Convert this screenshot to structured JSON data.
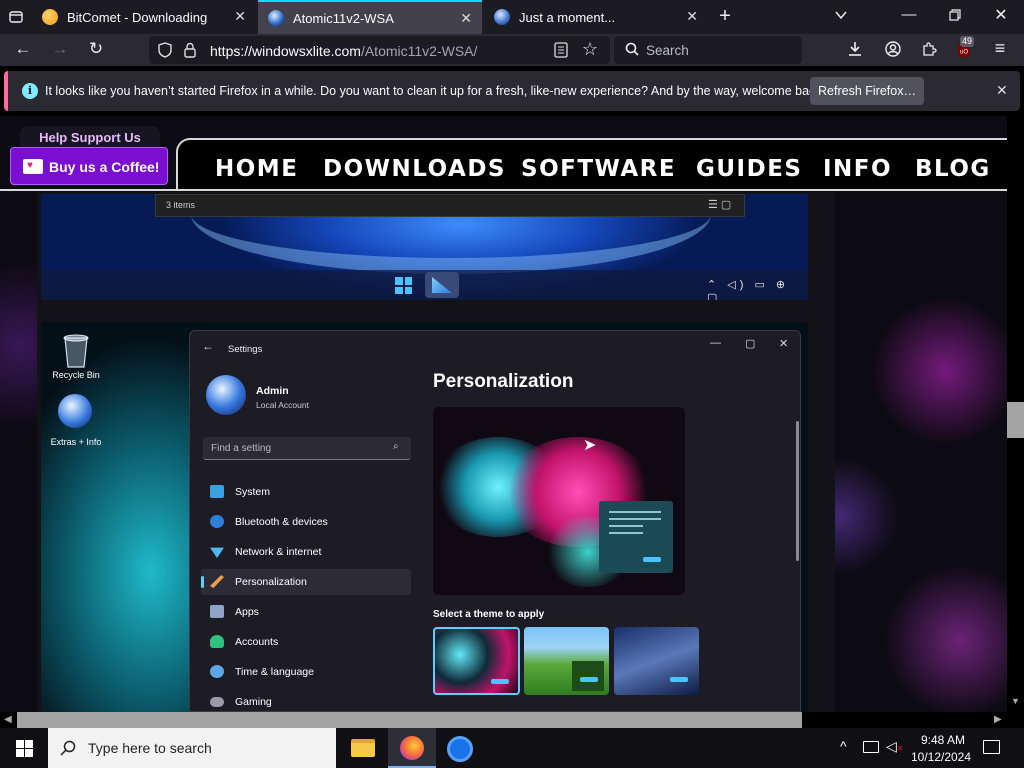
{
  "browser": {
    "tabs": [
      {
        "title": "BitComet - Downloading",
        "active": false
      },
      {
        "title": "Atomic11v2-WSA",
        "active": true
      },
      {
        "title": "Just a moment...",
        "active": false
      }
    ],
    "url_host": "https://windowsxlite.com",
    "url_path": "/Atomic11v2-WSA/",
    "search_placeholder": "Search",
    "extension_badge": "49",
    "notification": {
      "text": "It looks like you haven’t started Firefox in a while. Do you want to clean it up for a fresh, like-new experience? And by the way, welcome back!",
      "button": "Refresh Firefox…"
    }
  },
  "site": {
    "help_label": "Help Support Us",
    "coffee_label": "Buy us a Coffee!",
    "nav": [
      "HOME",
      "DOWNLOADS",
      "SOFTWARE",
      "GUIDES",
      "INFO",
      "BLOG"
    ]
  },
  "screenshot1": {
    "explorer_status": "3 items"
  },
  "screenshot2": {
    "desktop_icons": [
      "Recycle Bin",
      "Extras + Info"
    ],
    "window_title": "Settings",
    "user_name": "Admin",
    "user_type": "Local Account",
    "search_placeholder": "Find a setting",
    "page_title": "Personalization",
    "theme_label": "Select a theme to apply",
    "nav": [
      {
        "label": "System",
        "color": "#3aa0e0"
      },
      {
        "label": "Bluetooth & devices",
        "color": "#2d7fd8"
      },
      {
        "label": "Network & internet",
        "color": "#4fb6f0"
      },
      {
        "label": "Personalization",
        "color": "#e8a04a",
        "selected": true
      },
      {
        "label": "Apps",
        "color": "#8fa4c8"
      },
      {
        "label": "Accounts",
        "color": "#2ec27e"
      },
      {
        "label": "Time & language",
        "color": "#5aa8e8"
      },
      {
        "label": "Gaming",
        "color": "#9a9aa8"
      }
    ]
  },
  "taskbar": {
    "search_placeholder": "Type here to search",
    "time": "9:48 AM",
    "date": "10/12/2024"
  }
}
